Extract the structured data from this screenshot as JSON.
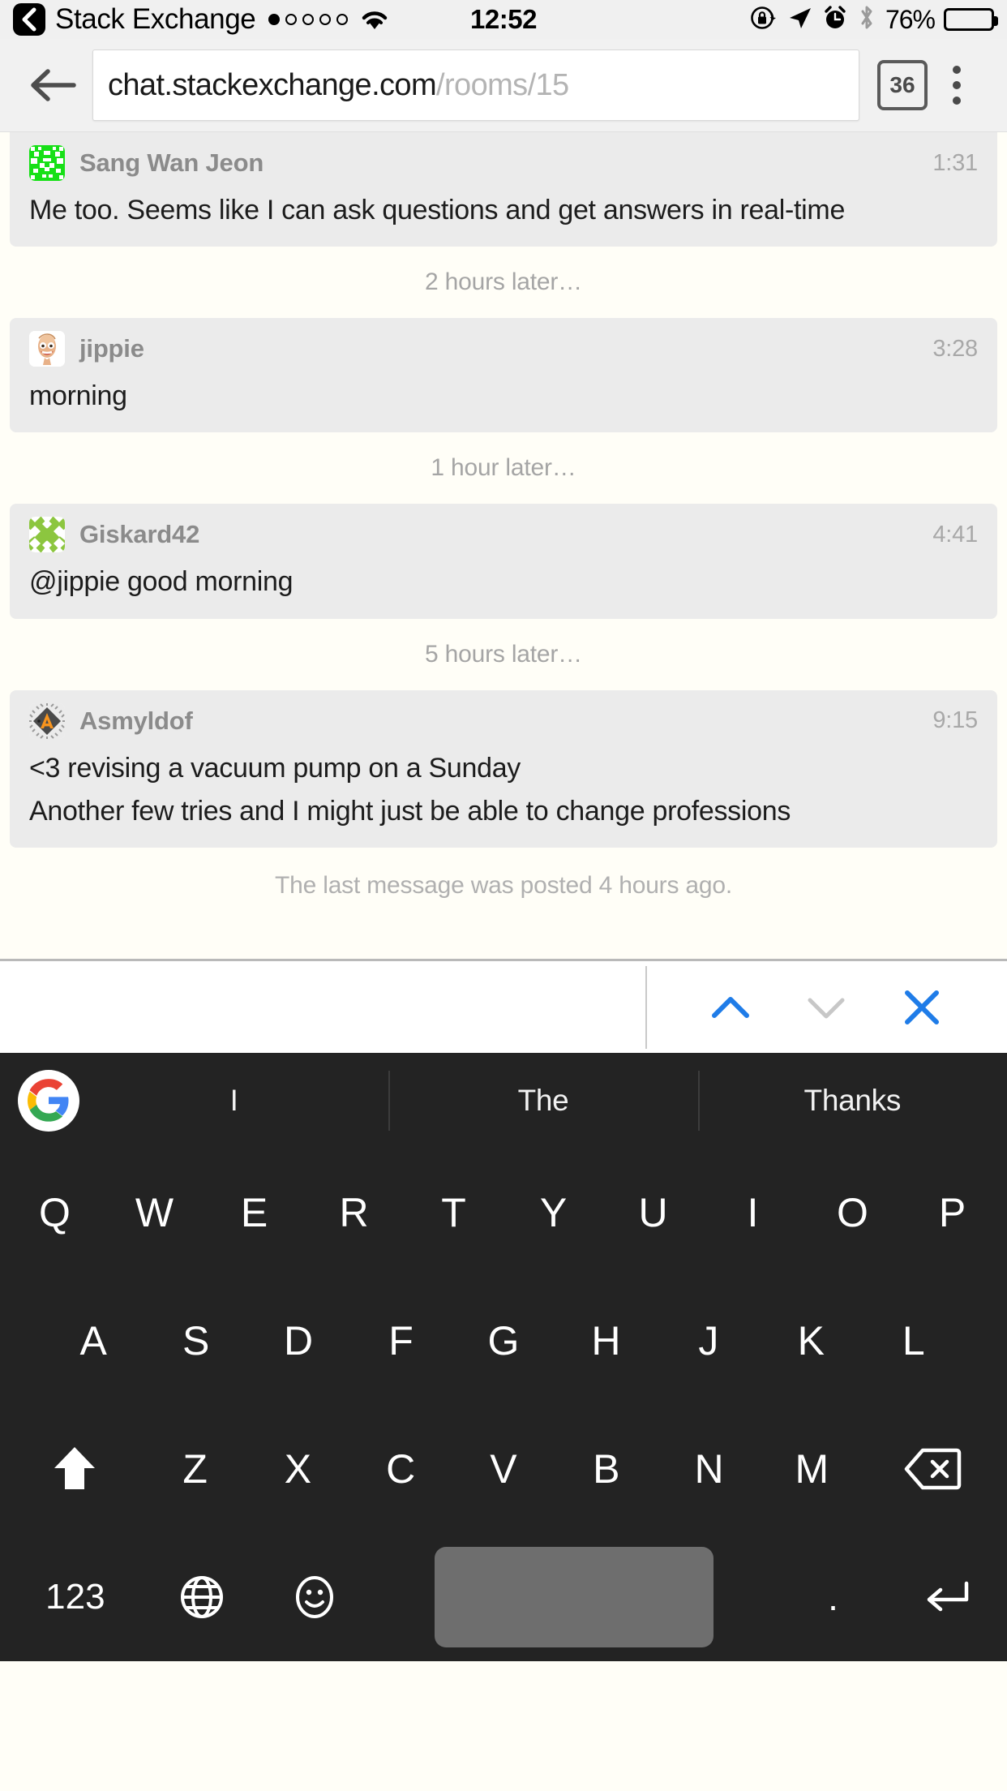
{
  "status_bar": {
    "back_label": "‹",
    "carrier": "Stack Exchange",
    "signal_dots": 5,
    "signal_filled": 1,
    "time": "12:52",
    "battery_percent": "76%",
    "icons": [
      "rotation-lock-icon",
      "location-arrow-icon",
      "alarm-clock-icon",
      "bluetooth-icon"
    ]
  },
  "browser": {
    "back_icon": "back-arrow-icon",
    "url_visible": "chat.stackexchange.com",
    "url_path": "/rooms/15",
    "tab_count": "36",
    "menu_icon": "overflow-menu-icon"
  },
  "chat": {
    "messages": [
      {
        "user": "Sang Wan Jeon",
        "time": "1:31",
        "avatar": "identicon-green",
        "lines": [
          "Me too. Seems like I can ask questions and get answers in real-time"
        ]
      },
      {
        "user": "jippie",
        "time": "3:28",
        "avatar": "caricature-face",
        "lines": [
          "morning"
        ]
      },
      {
        "user": "Giskard42",
        "time": "4:41",
        "avatar": "identicon-lightgreen",
        "lines": [
          "@jippie good morning"
        ]
      },
      {
        "user": "Asmyldof",
        "time": "9:15",
        "avatar": "chip-orange-a",
        "lines": [
          "<3 revising a vacuum pump on a Sunday",
          "Another few tries and I might just be able to change professions"
        ]
      }
    ],
    "separators": [
      "2 hours later…",
      "1 hour later…",
      "5 hours later…"
    ],
    "last_message_note": "The last message was posted 4 hours ago."
  },
  "find_bar": {
    "prev_icon": "chevron-up-icon",
    "next_icon": "chevron-down-icon",
    "close_icon": "close-x-icon",
    "prev_color": "#1f7ce8",
    "next_color": "#c7c7c7",
    "close_color": "#1f7ce8"
  },
  "keyboard": {
    "logo": "google-g-logo",
    "suggestions": [
      "I",
      "The",
      "Thanks"
    ],
    "row1": [
      "Q",
      "W",
      "E",
      "R",
      "T",
      "Y",
      "U",
      "I",
      "O",
      "P"
    ],
    "row2": [
      "A",
      "S",
      "D",
      "F",
      "G",
      "H",
      "J",
      "K",
      "L"
    ],
    "row3": [
      "Z",
      "X",
      "C",
      "V",
      "B",
      "N",
      "M"
    ],
    "shift_icon": "shift-up-icon",
    "backspace_icon": "backspace-delete-icon",
    "numbers_key": "123",
    "globe_icon": "language-globe-icon",
    "emoji_icon": "emoji-smiley-icon",
    "space_key": "spacebar",
    "period_key": ".",
    "enter_icon": "enter-return-icon"
  }
}
